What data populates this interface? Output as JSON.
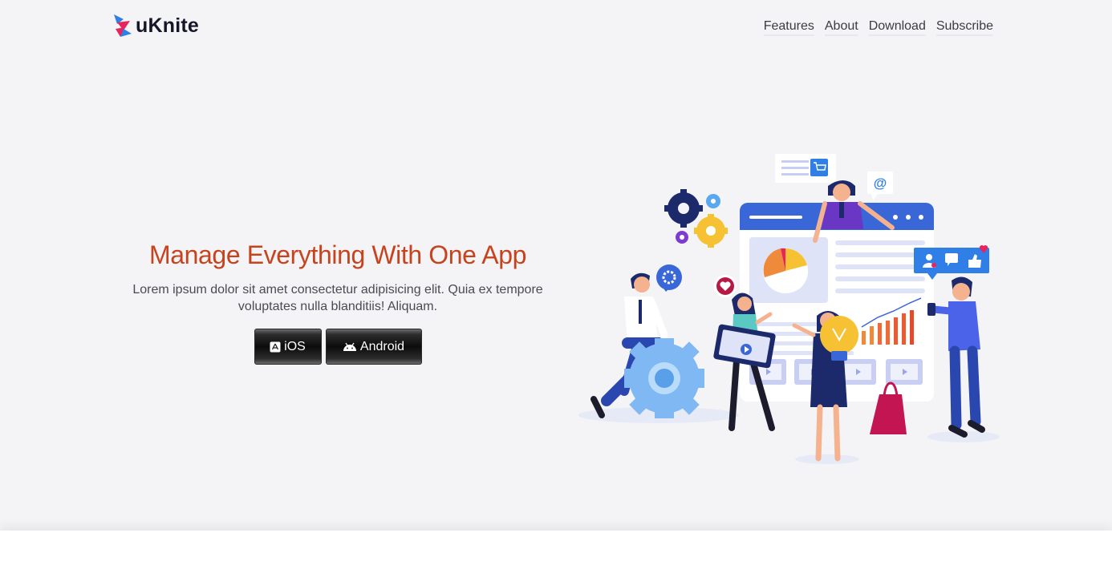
{
  "brand": {
    "name": "uKnite",
    "colors": {
      "pink": "#e8245f",
      "blue": "#2f7fe6",
      "accent": "#c6431d"
    }
  },
  "nav": {
    "items": [
      "Features",
      "About",
      "Download",
      "Subscribe"
    ]
  },
  "hero": {
    "title": "Manage Everything With One App",
    "description_line1": "Lorem ipsum dolor sit amet consectetur adipisicing elit. Quia ex tempore",
    "description_line2": "voluptates nulla blanditiis! Aliquam.",
    "buttons": {
      "ios": {
        "label": "iOS",
        "icon": "app-store-icon"
      },
      "android": {
        "label": "Android",
        "icon": "android-icon"
      }
    }
  },
  "illustration": {
    "email_symbol": "@",
    "icons": [
      "gear-icon",
      "cart-icon",
      "heart-icon",
      "user-icon",
      "chat-icon",
      "thumbs-up-icon",
      "lightbulb-icon",
      "play-icon",
      "shopping-bag-icon"
    ]
  }
}
